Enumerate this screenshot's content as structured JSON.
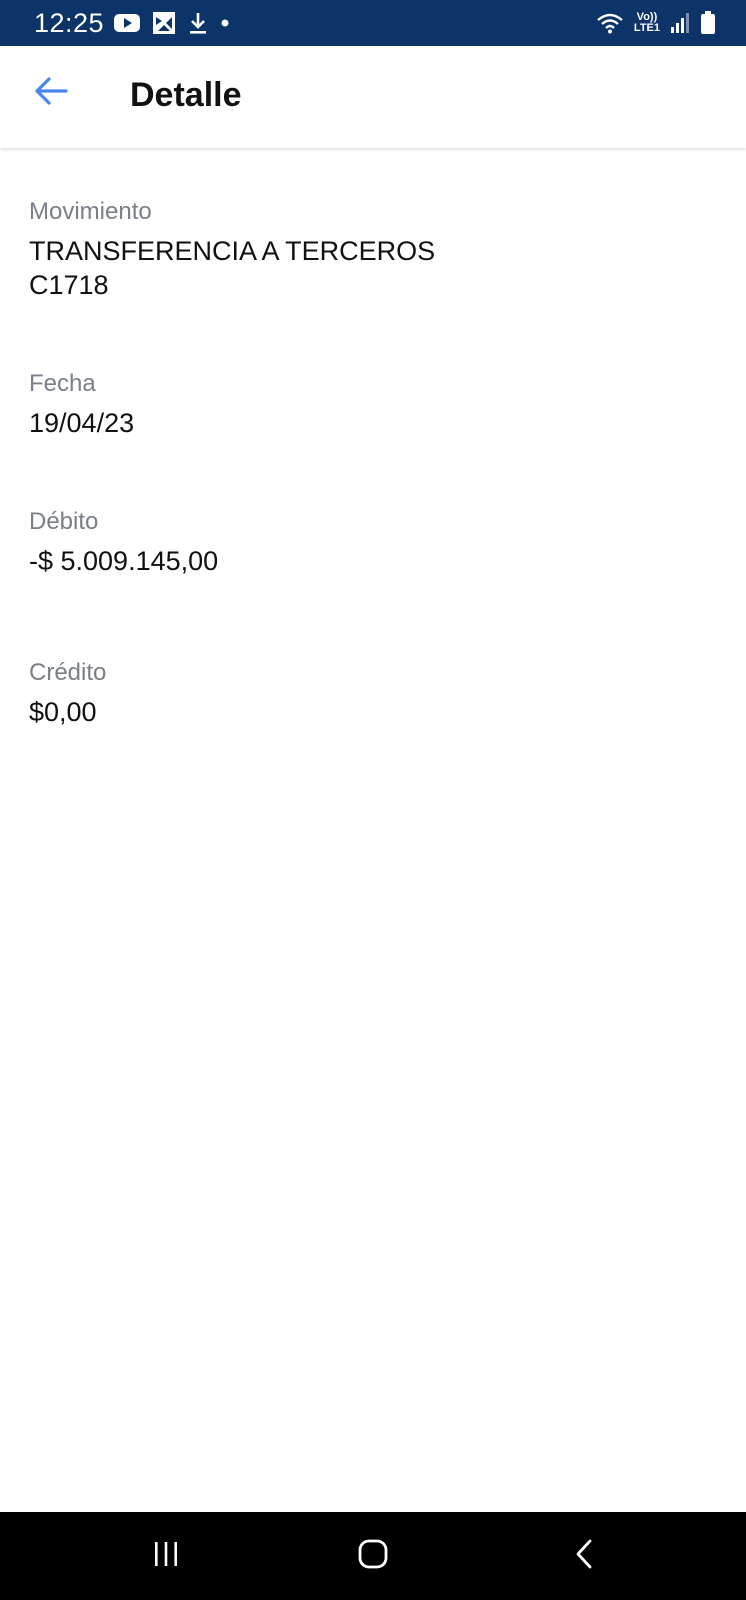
{
  "status_bar": {
    "time": "12:25",
    "icons_left": [
      "youtube-icon",
      "photos-icon",
      "download-icon",
      "dot-icon"
    ],
    "network_label_top": "Vo))",
    "network_label_bottom": "LTE1",
    "icons_right": [
      "wifi-icon",
      "volte-lte-indicator",
      "signal-icon",
      "battery-icon"
    ]
  },
  "header": {
    "title": "Detalle",
    "back_icon": "arrow-left-icon",
    "accent_color": "#4a86e8"
  },
  "details": [
    {
      "label": "Movimiento",
      "value_lines": [
        "TRANSFERENCIA A TERCEROS",
        "C1718"
      ]
    },
    {
      "label": "Fecha",
      "value_lines": [
        "19/04/23"
      ]
    },
    {
      "label": "Débito",
      "value_lines": [
        "-$ 5.009.145,00"
      ]
    },
    {
      "label": "Crédito",
      "value_lines": [
        "$0,00"
      ]
    }
  ],
  "nav_bar": {
    "buttons": [
      "recents-icon",
      "home-icon",
      "back-icon"
    ]
  },
  "colors": {
    "status_bar": "#0d3468",
    "label": "#7a7f88",
    "value": "#111111",
    "nav_bar": "#000000"
  }
}
